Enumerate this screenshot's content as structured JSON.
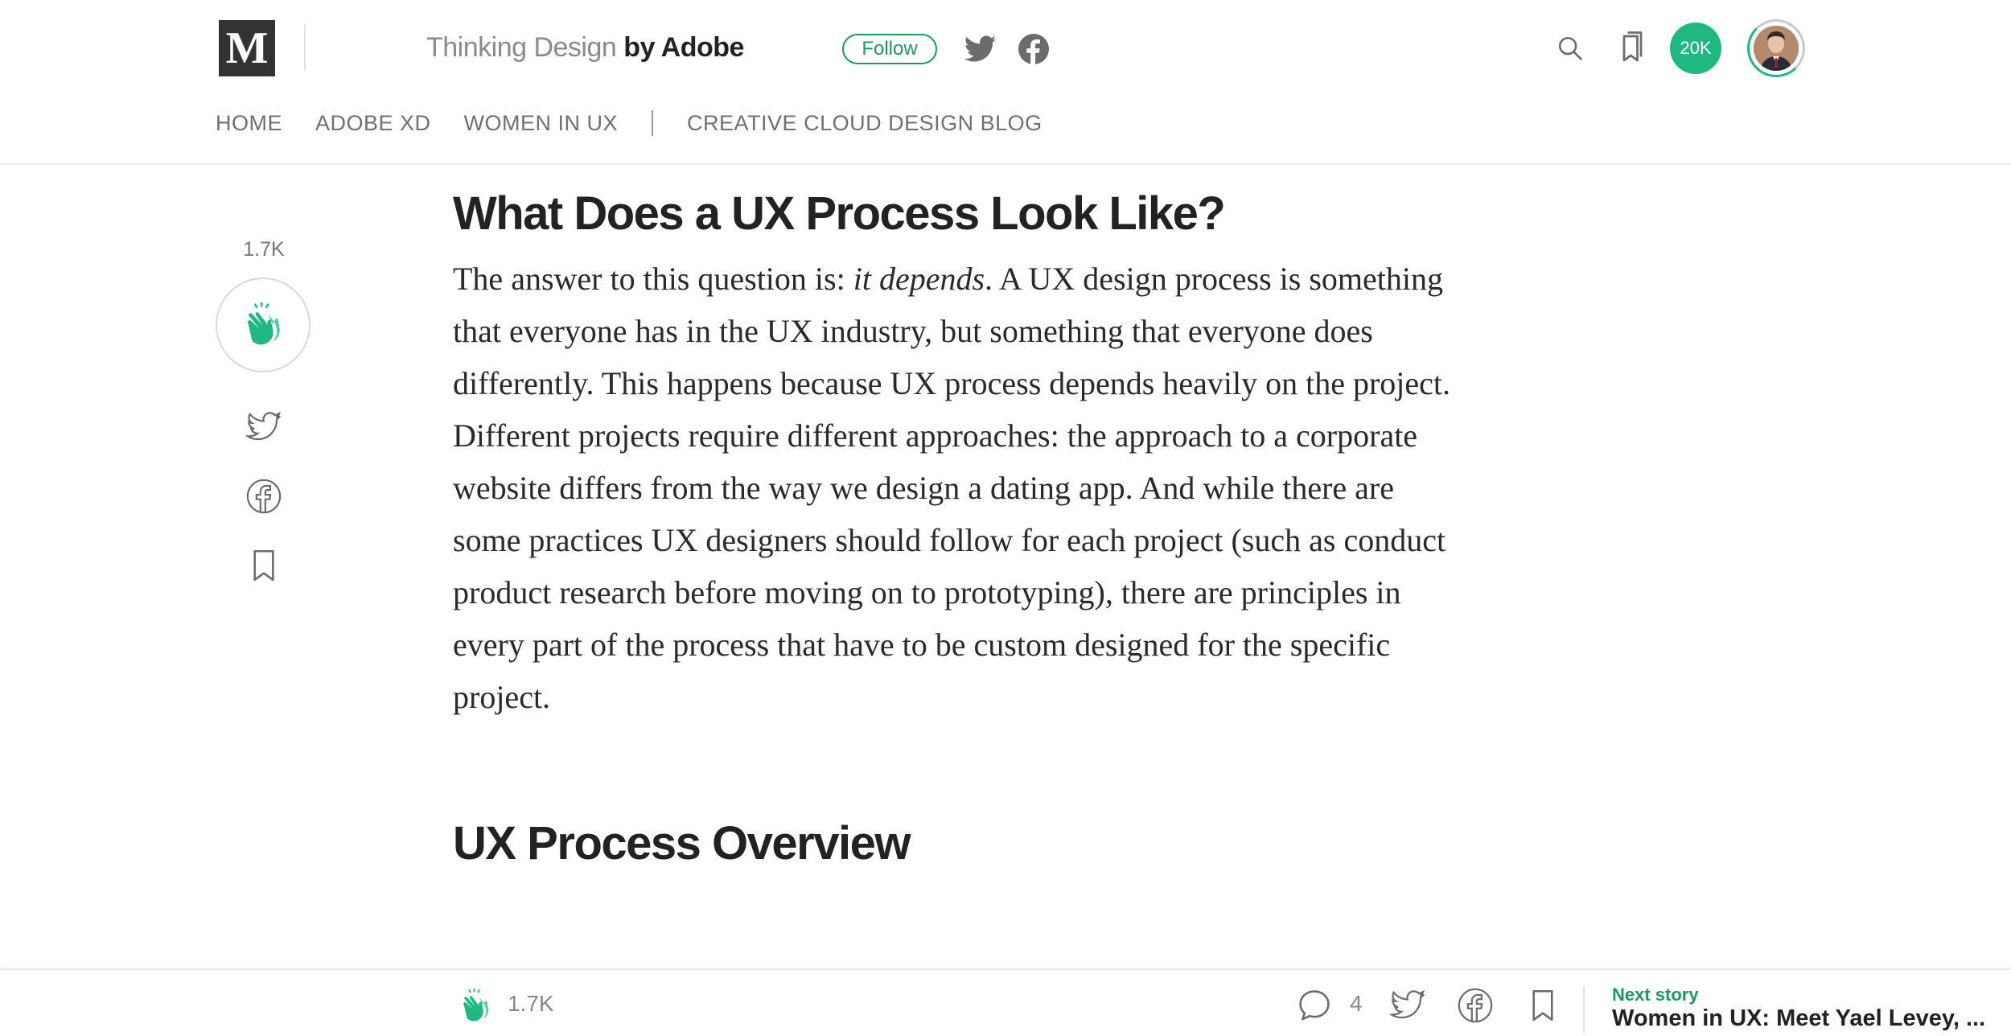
{
  "header": {
    "logo_letter": "M",
    "pub_name_light": "Thinking Design",
    "pub_name_dark": "by Adobe",
    "follow_label": "Follow",
    "followers_badge": "20K"
  },
  "nav": {
    "items": [
      "HOME",
      "ADOBE XD",
      "WOMEN IN UX",
      "CREATIVE CLOUD DESIGN BLOG"
    ]
  },
  "rail": {
    "clap_count": "1.7K"
  },
  "article": {
    "heading_1": "What Does a UX Process Look Like?",
    "paragraph": {
      "line_1_a": "The answer to this question is: ",
      "line_1_em": "it depends",
      "line_1_b": ". A UX design process is something",
      "line_2": "that everyone has in the UX industry, but something that everyone does",
      "line_3": "differently. This happens because UX process depends heavily on the project.",
      "line_4": "Different projects require different approaches: the approach to a corporate",
      "line_5": "website differs from the way we design a dating app. And while there are",
      "line_6": "some practices UX designers should follow for each project (such as conduct",
      "line_7": "product research before moving on to prototyping), there are principles in",
      "line_8": "every part of the process that have to be custom designed for the specific",
      "line_9": "project."
    },
    "heading_2": "UX Process Overview"
  },
  "bottombar": {
    "clap_count": "1.7K",
    "comment_count": "4",
    "next_label": "Next story",
    "next_title": "Women in UX: Meet Yael Levey, ..."
  },
  "colors": {
    "accent_green": "#1c9963",
    "badge_green": "#1fb880",
    "text_dark": "#222222",
    "text_muted": "#707070"
  },
  "icons": {
    "search": "search-icon",
    "bookmarks": "bookmarks-icon",
    "twitter": "twitter-icon",
    "facebook": "facebook-icon",
    "clap": "clap-icon",
    "comment": "comment-icon",
    "bookmark": "bookmark-icon"
  }
}
